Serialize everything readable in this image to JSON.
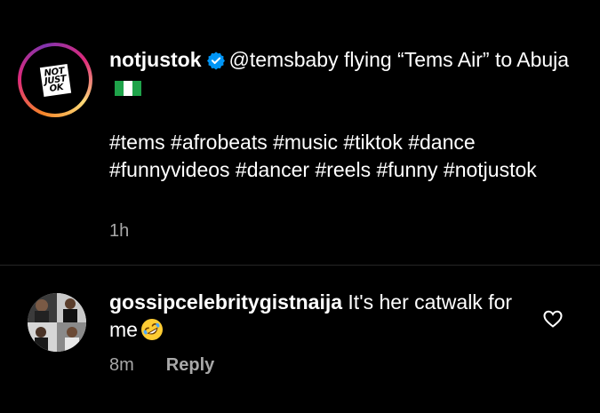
{
  "post": {
    "username": "notjustok",
    "avatar_logo_lines": [
      "NOT",
      "JUST",
      "OK"
    ],
    "caption_mention": "@temsbaby",
    "caption_text": " flying “Tems Air” to Abuja",
    "flag_icon": "nigeria-flag-icon",
    "hashtags": "#tems #afrobeats #music #tiktok #dance #funnyvideos #dancer #reels #funny #notjustok",
    "time": "1h"
  },
  "comment": {
    "username": "gossipcelebritygistnaija",
    "text": " It's her catwalk for me",
    "emoji_icon": "rolling-on-floor-laughing-emoji",
    "time": "8m",
    "reply_label": "Reply",
    "like_icon": "heart-outline-icon"
  },
  "colors": {
    "background": "#000000",
    "text": "#ffffff",
    "muted": "#a8a8a8",
    "verified": "#0095f6",
    "divider": "#262626"
  }
}
